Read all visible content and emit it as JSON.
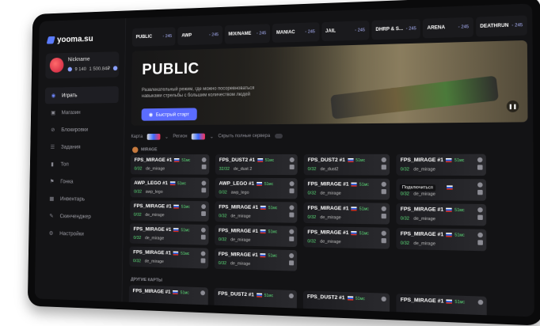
{
  "logo": "yooma.su",
  "user": {
    "name": "Nickname",
    "balance_a": "9 140",
    "balance_b": "1 500.84₽"
  },
  "nav": [
    {
      "label": "Играть",
      "icon": "play-icon",
      "active": true
    },
    {
      "label": "Магазин",
      "icon": "store-icon"
    },
    {
      "label": "Блокировки",
      "icon": "ban-icon"
    },
    {
      "label": "Задания",
      "icon": "tasks-icon"
    },
    {
      "label": "Топ",
      "icon": "chart-icon"
    },
    {
      "label": "Гонка",
      "icon": "race-icon"
    },
    {
      "label": "Инвентарь",
      "icon": "inventory-icon"
    },
    {
      "label": "Скинченджер",
      "icon": "skin-icon"
    },
    {
      "label": "Настройки",
      "icon": "gear-icon"
    }
  ],
  "tabs": [
    {
      "label": "PUBLIC",
      "count": "245"
    },
    {
      "label": "AWP",
      "count": "245"
    },
    {
      "label": "MIX/NAME",
      "count": "245"
    },
    {
      "label": "MANIAC",
      "count": "245"
    },
    {
      "label": "JAIL",
      "count": "245"
    },
    {
      "label": "DHRP & S...",
      "count": "245"
    },
    {
      "label": "ARENA",
      "count": "245"
    },
    {
      "label": "DEATHRUN",
      "count": "245"
    }
  ],
  "banner": {
    "title": "PUBLIC",
    "description": "Развлекательный режим, где можно посоревноваться навыками стрельбы с большим количеством людей",
    "button": "Быстрый старт"
  },
  "filters": {
    "map_label": "Карта",
    "region_label": "Регион",
    "hide_full": "Скрыть полные сервера"
  },
  "section": "MIRAGE",
  "other_section": "ДРУГИЕ КАРТЫ",
  "columns": [
    [
      {
        "name": "FPS_MIRAGE #1",
        "ping": "51мс",
        "players": "0/32",
        "map": "de_mirage"
      },
      {
        "name": "AWP_LEGO #1",
        "ping": "51мс",
        "players": "0/32",
        "map": "awp_lego"
      },
      {
        "name": "FPS_MIRAGE #1",
        "ping": "51мс",
        "players": "0/32",
        "map": "de_mirage"
      },
      {
        "name": "FPS_MIRAGE #1",
        "ping": "51мс",
        "players": "0/32",
        "map": "de_mirage"
      },
      {
        "name": "FPS_MIRAGE #1",
        "ping": "51мс",
        "players": "0/32",
        "map": "de_mirage"
      }
    ],
    [
      {
        "name": "FPS_DUST2 #1",
        "ping": "51мс",
        "players": "32/32",
        "map": "de_dust 2"
      },
      {
        "name": "AWP_LEGO #1",
        "ping": "51мс",
        "players": "0/32",
        "map": "awp_lego"
      },
      {
        "name": "FPS_MIRAGE #1",
        "ping": "51мс",
        "players": "0/32",
        "map": "de_mirage"
      },
      {
        "name": "FPS_MIRAGE #1",
        "ping": "51мс",
        "players": "0/32",
        "map": "de_mirage"
      },
      {
        "name": "FPS_MIRAGE #1",
        "ping": "51мс",
        "players": "0/32",
        "map": "de_mirage"
      }
    ],
    [
      {
        "name": "FPS_DUST2 #1",
        "ping": "51мс",
        "players": "0/32",
        "map": "de_dust2"
      },
      {
        "name": "FPS_MIRAGE #1",
        "ping": "51мс",
        "players": "0/32",
        "map": "de_mirage"
      },
      {
        "name": "FPS_MIRAGE #1",
        "ping": "51мс",
        "players": "0/32",
        "map": "de_mirage"
      },
      {
        "name": "FPS_MIRAGE #1",
        "ping": "51мс",
        "players": "0/32",
        "map": "de_mirage"
      }
    ],
    [
      {
        "name": "FPS_MIRAGE #1",
        "ping": "51мс",
        "players": "0/32",
        "map": "de_mirage"
      },
      {
        "name": "FPS_MIRAGE #1",
        "ping": "51мс",
        "players": "0/32",
        "map": "de_mirage",
        "hover": "Подключиться"
      },
      {
        "name": "FPS_MIRAGE #1",
        "ping": "51мс",
        "players": "0/32",
        "map": "de_mirage"
      },
      {
        "name": "FPS_MIRAGE #1",
        "ping": "51мс",
        "players": "0/32",
        "map": "de_mirage"
      }
    ]
  ],
  "other": [
    {
      "name": "FPS_MIRAGE #1",
      "ping": "51мс"
    },
    {
      "name": "FPS_DUST2 #1",
      "ping": "51мс"
    },
    {
      "name": "FPS_DUST2 #1",
      "ping": "51мс"
    },
    {
      "name": "FPS_MIRAGE #1",
      "ping": "51мс"
    }
  ],
  "colors": {
    "accent": "#5b6cff",
    "ping": "#5de07a",
    "bg": "#131315"
  }
}
